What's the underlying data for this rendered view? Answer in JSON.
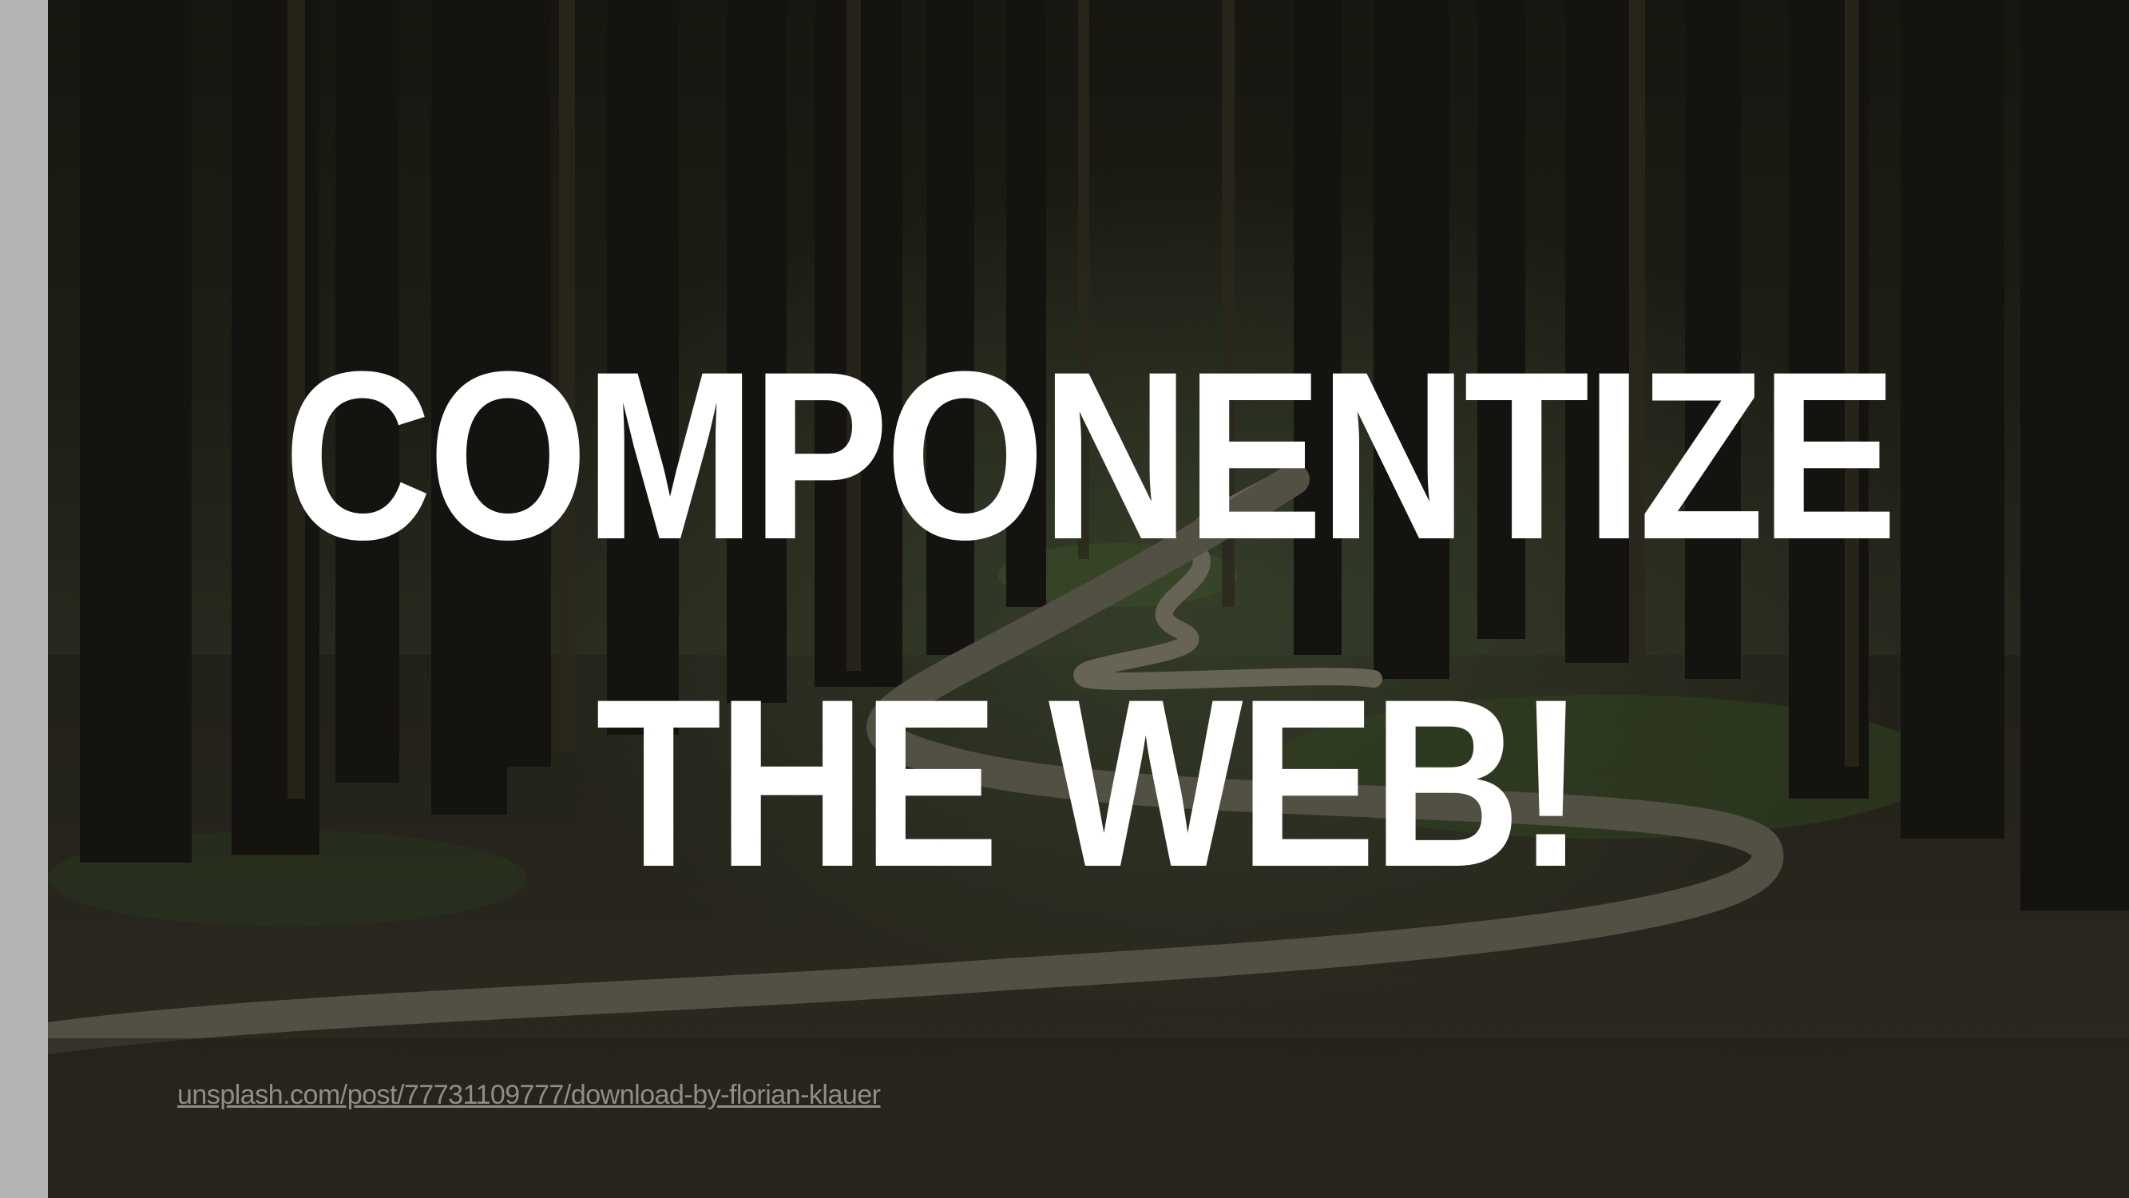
{
  "slide": {
    "title_line1": "COMPONENTIZE",
    "title_line2": "THE WEB!",
    "credit_link": "unsplash.com/post/77731109777/download-by-florian-klauer",
    "background_image": "forest-path-photo"
  },
  "colors": {
    "side_bar": "#b3b3b3",
    "title_text": "#ffffff",
    "credit_text": "#8e8e86",
    "forest_dark": "#1f1e16"
  }
}
